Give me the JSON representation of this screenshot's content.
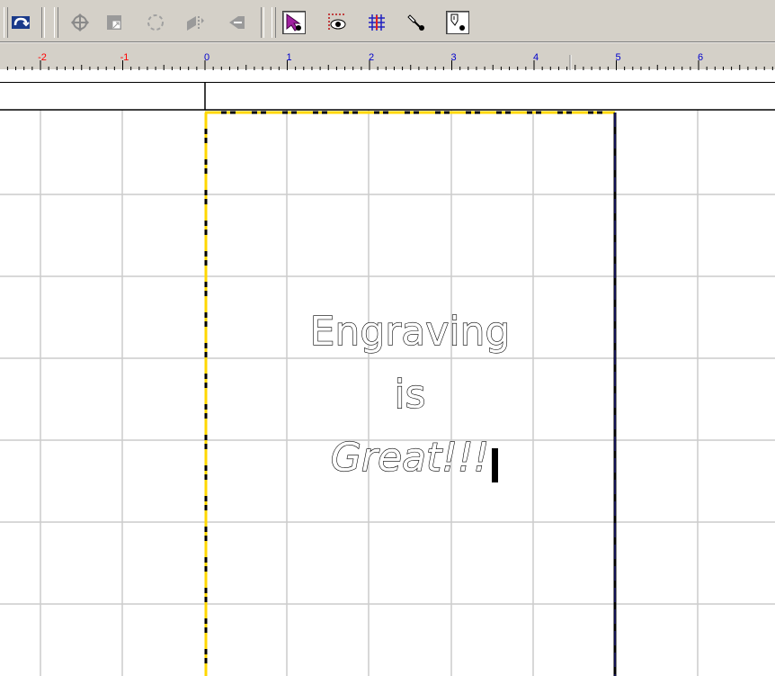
{
  "app": {
    "toolbar": {
      "buttons": [
        {
          "name": "redo-icon",
          "pressed": false
        },
        {
          "name": "move-icon",
          "pressed": false
        },
        {
          "name": "scale-icon",
          "pressed": false
        },
        {
          "name": "rotate-icon",
          "pressed": false
        },
        {
          "name": "mirror-icon",
          "pressed": false
        },
        {
          "name": "slant-icon",
          "pressed": false
        },
        {
          "name": "select-arrow-icon",
          "pressed": true
        },
        {
          "name": "preview-eye-icon",
          "pressed": false
        },
        {
          "name": "grid-snap-icon",
          "pressed": false
        },
        {
          "name": "tool-pick-icon",
          "pressed": false
        },
        {
          "name": "tool-path-icon",
          "pressed": true
        }
      ]
    },
    "ruler": {
      "labels": [
        "-2",
        "-1",
        "0",
        "1",
        "2",
        "3",
        "4",
        "5",
        "6"
      ],
      "negative_color": "#ff0000",
      "positive_color": "#0000cc"
    },
    "canvas": {
      "text_lines": [
        "Engraving",
        "is",
        "Great!!!"
      ],
      "border_color": "#ffd700",
      "grid_color": "#cccccc"
    }
  }
}
